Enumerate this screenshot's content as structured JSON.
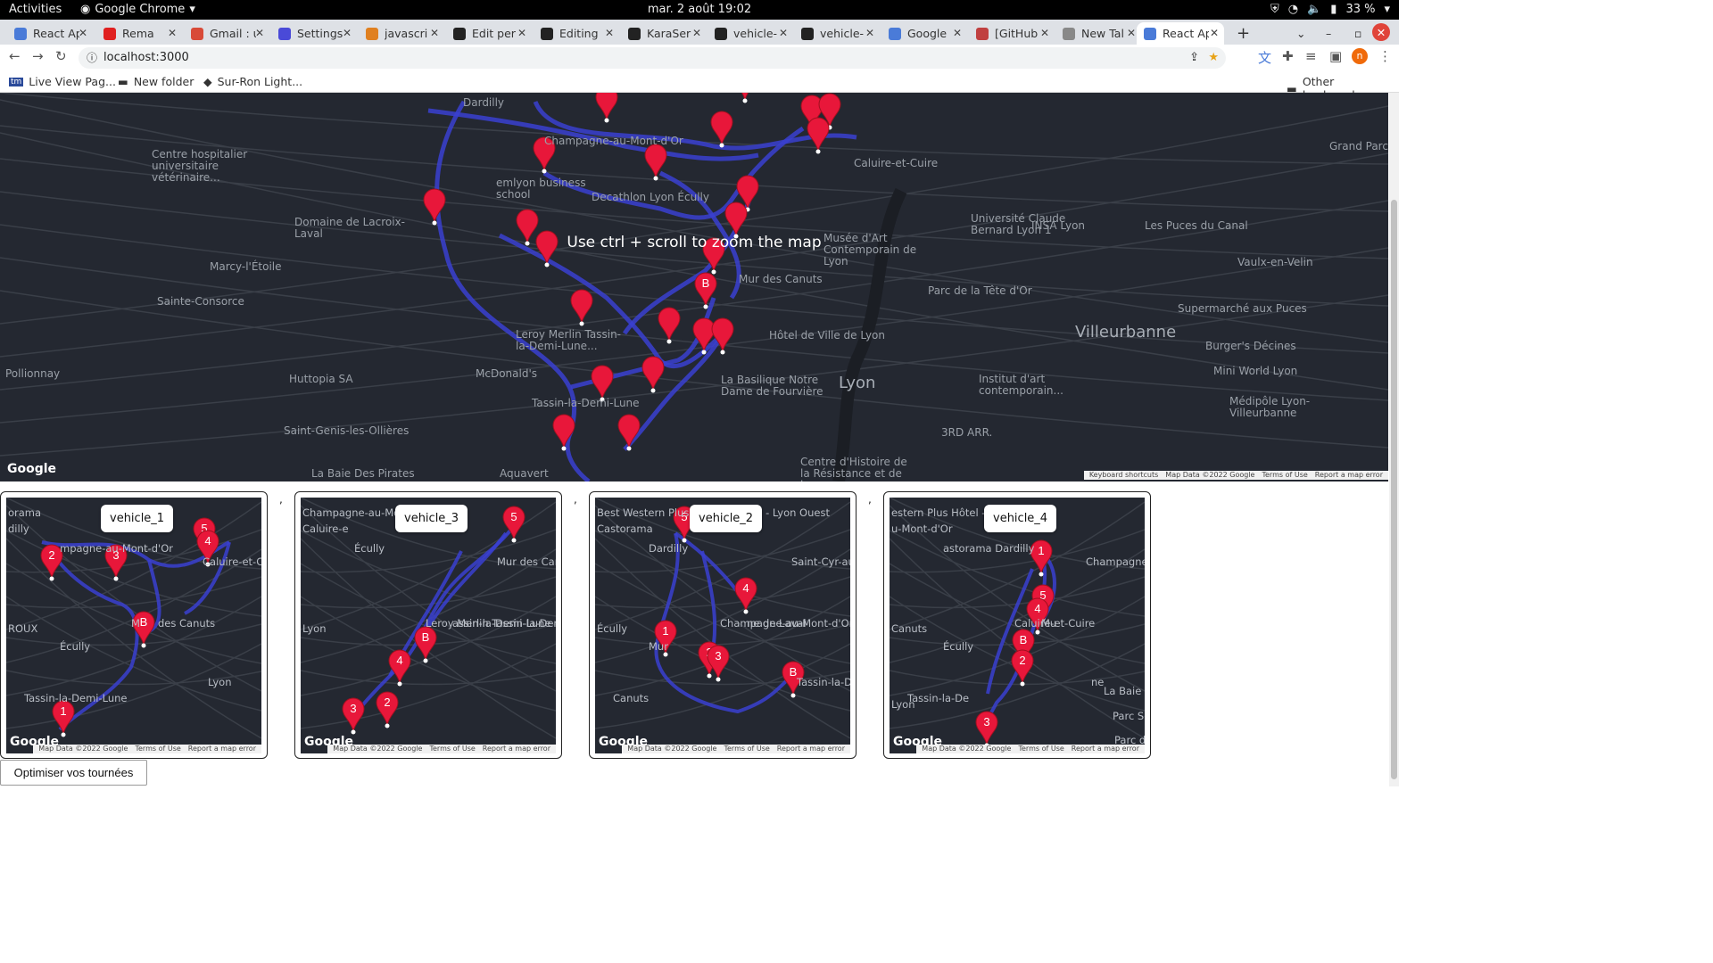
{
  "system": {
    "activities": "Activities",
    "app": "Google Chrome",
    "clock": "mar. 2 août  19:02",
    "battery": "33 %"
  },
  "tabs": [
    {
      "title": "React Ap",
      "color": "#4a7bd8"
    },
    {
      "title": "Rema",
      "color": "#e02020"
    },
    {
      "title": "Gmail : u",
      "color": "#d84a38"
    },
    {
      "title": "Settings",
      "color": "#4a4ad8"
    },
    {
      "title": "javascri",
      "color": "#e08020"
    },
    {
      "title": "Edit per",
      "color": "#222"
    },
    {
      "title": "Editing",
      "color": "#222"
    },
    {
      "title": "KaraSer",
      "color": "#222"
    },
    {
      "title": "vehicle-",
      "color": "#222"
    },
    {
      "title": "vehicle-",
      "color": "#222"
    },
    {
      "title": "Google",
      "color": "#4a7bd8"
    },
    {
      "title": "[GitHub",
      "color": "#c04040"
    },
    {
      "title": "New Tal",
      "color": "#888"
    },
    {
      "title": "React Ap",
      "color": "#4a7bd8",
      "active": true
    }
  ],
  "address": "localhost:3000",
  "bookmarks": {
    "items": [
      "Live View Pag...",
      "New folder",
      "Sur-Ron Light..."
    ],
    "other": "Other bookmarks"
  },
  "main_map": {
    "message": "Use ctrl + scroll to zoom the map",
    "labels": [
      "Dardilly",
      "Champagne-au-Mont-d'Or",
      "Caluire-et-Cuire",
      "Centre hospitalier universitaire vétérinaire...",
      "Decathlon Lyon Écully",
      "emlyon business school",
      "Domaine de Lacroix-Laval",
      "Marcy-l'Étoile",
      "Sainte-Consorce",
      "Musée d'Art Contemporain de Lyon",
      "Université Claude Bernard Lyon 1",
      "INSA Lyon",
      "Les Puces du Canal",
      "Grand Parc Miribel Jonage",
      "Vaulx-en-Velin",
      "Mur des Canuts",
      "Parc de la Tête d'Or",
      "Supermarché aux Puces",
      "Villeurbanne",
      "Leroy Merlin Tassin-la-Demi-Lune...",
      "Hôtel de Ville de Lyon",
      "Burger's Décines",
      "Pollionnay",
      "Huttopia SA",
      "McDonald's",
      "La Basilique Notre Dame de Fourvière",
      "Lyon",
      "Institut d'art contemporain...",
      "Mini World Lyon",
      "Médipôle Lyon-Villeurbanne",
      "Tassin-la-Demi-Lune",
      "Saint-Genis-les-Ollières",
      "3RD ARR.",
      "La Baie Des Pirates",
      "Aquavert",
      "Centre d'Histoire de la Résistance et de la..."
    ],
    "footer": [
      "Keyboard shortcuts",
      "Map Data ©2022 Google",
      "Terms of Use",
      "Report a map error"
    ]
  },
  "vehicles": [
    {
      "name": "vehicle_1",
      "markers": [
        "2",
        "3",
        "5",
        "4",
        "B",
        "1"
      ],
      "labels": [
        "orama",
        "dilly",
        "mpagne-au-Mont-d'Or",
        "Caluire-et-C",
        "M",
        "des Canuts",
        "ROUX",
        "Écully",
        "Tassin-la-Demi-Lune",
        "Lyon"
      ]
    },
    {
      "name": "vehicle_3",
      "markers": [
        "5",
        "B",
        "4",
        "2",
        "3"
      ],
      "labels": [
        "Champagne-au-Mont-d'Or",
        "Caluire-e",
        "Écully",
        "Mur des Canuts",
        "Leroy Merlin Tassin-la-Demi-Lune...",
        "assin-la-Demi-Lune",
        "Lyon"
      ]
    },
    {
      "name": "vehicle_2",
      "markers": [
        "5",
        "4",
        "1",
        "2",
        "3",
        "B"
      ],
      "labels": [
        "Best Western Plus Hôtel Admiral - Lyon Ouest",
        "Castorama",
        "Dardilly",
        "Saint-Cyr-au-Mon",
        "Champagne-au-Mont-d'Or",
        "ne de Laval",
        "Écully",
        "Mur",
        "Canuts",
        "Tassin-la-Demi-Lune"
      ]
    },
    {
      "name": "vehicle_4",
      "markers": [
        "1",
        "5",
        "4",
        "B",
        "2",
        "3"
      ],
      "labels": [
        "estern Plus Hôtel - Lyon Ouest",
        "u-Mont-d'Or",
        "astorama Dardilly",
        "Champagne-au-Mont-d'Or",
        "Caluire-et-Cuire",
        "Mu",
        "Canuts",
        "Écully",
        "Tassin-la-De",
        "ne",
        "Lyon",
        "La Baie Des Pirates",
        "Parc Ser Bland",
        "Parc de Tête d"
      ]
    }
  ],
  "mini_footer": [
    "Map Data ©2022 Google",
    "Terms of Use",
    "Report a map error"
  ],
  "separator": ",",
  "google": "Google",
  "button": "Optimiser vos tournées"
}
